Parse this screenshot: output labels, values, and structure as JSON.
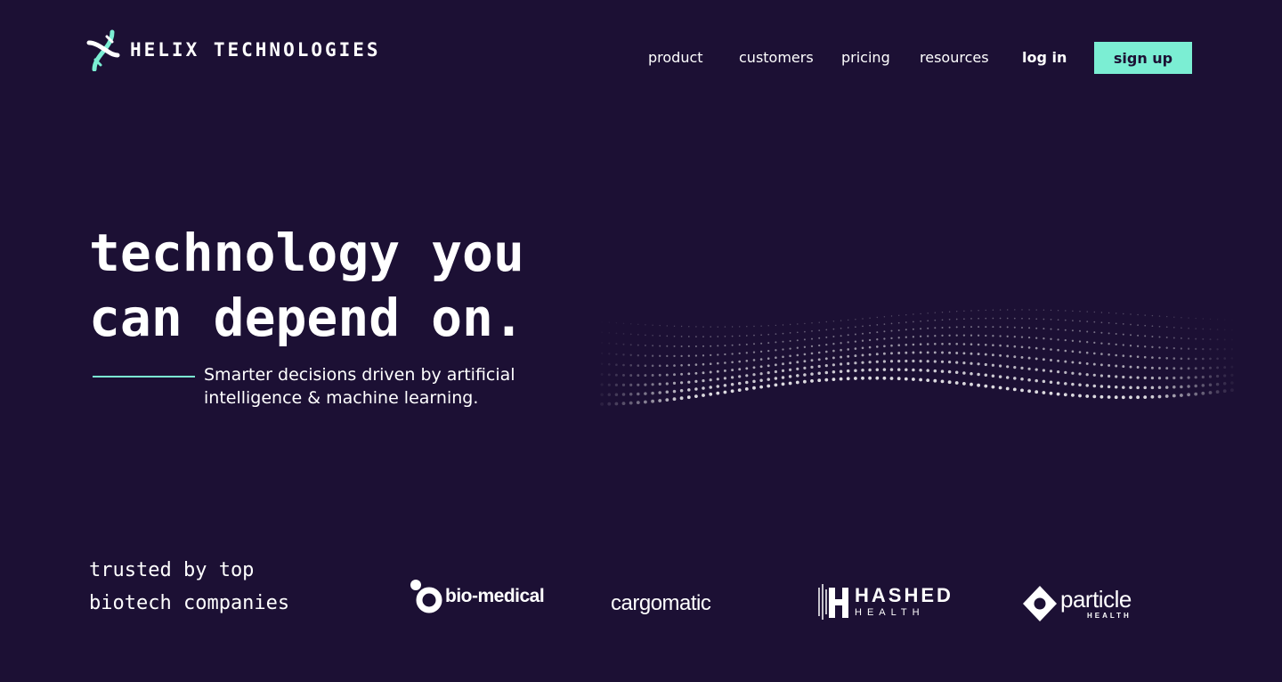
{
  "brand": {
    "name": "HELIX TECHNOLOGIES",
    "logo_icon": "dna-helix-icon",
    "colors": {
      "background": "#1c1034",
      "accent": "#7beed3",
      "text": "#ffffff"
    }
  },
  "nav": {
    "items": [
      {
        "label": "product"
      },
      {
        "label": "customers"
      },
      {
        "label": "pricing"
      },
      {
        "label": "resources"
      }
    ],
    "login_label": "log in",
    "signup_label": "sign up"
  },
  "hero": {
    "headline_lines": [
      "technology you",
      "can depend on."
    ],
    "subhead_lines": [
      "Smarter decisions driven by artificial",
      "intelligence & machine learning."
    ],
    "graphic": "particle-wave-graphic"
  },
  "trusted": {
    "heading_lines": [
      "trusted by top",
      "biotech companies"
    ],
    "logos": [
      {
        "name": "bio-medical",
        "icon": "bio-medical-logo-mark"
      },
      {
        "name": "cargomatic",
        "icon": "cargomatic-power-icon"
      },
      {
        "name": "HASHED",
        "subtitle": "HEALTH",
        "icon": "hashed-health-logo-mark"
      },
      {
        "name": "particle",
        "subtitle": "HEALTH",
        "icon": "particle-diamond-logo-mark"
      }
    ]
  }
}
